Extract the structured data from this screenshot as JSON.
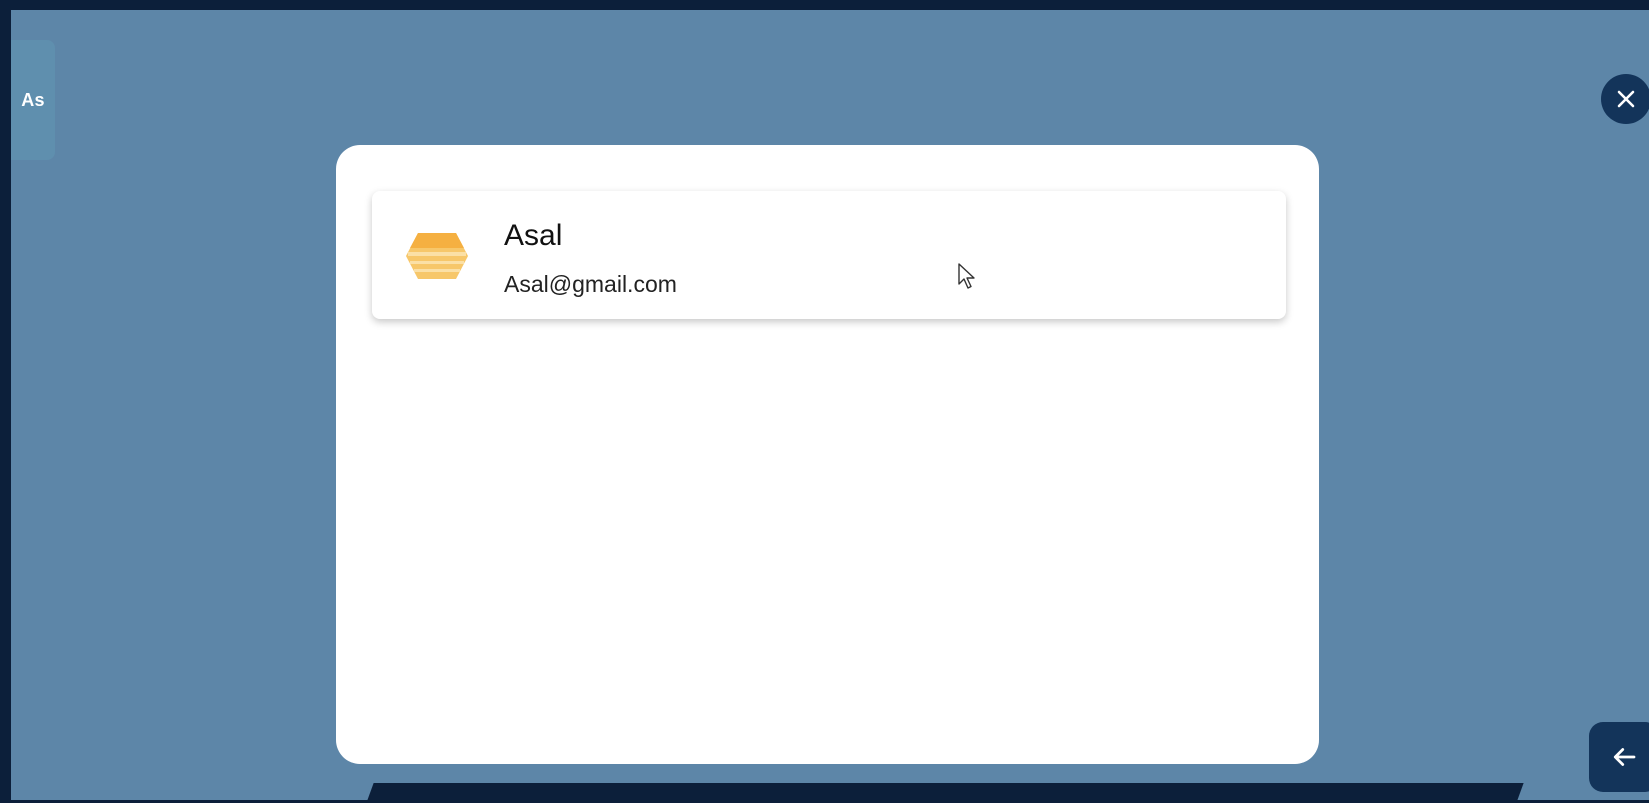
{
  "side_tab": {
    "label": "As"
  },
  "account": {
    "name": "Asal",
    "email": "Asal@gmail.com"
  },
  "icons": {
    "close": "close-icon",
    "back": "arrow-left-icon",
    "avatar": "hexagon-avatar-icon"
  },
  "colors": {
    "background": "#5d86a8",
    "frame": "#0c1f3a",
    "button": "#13345a",
    "avatar": "#f5b041"
  }
}
